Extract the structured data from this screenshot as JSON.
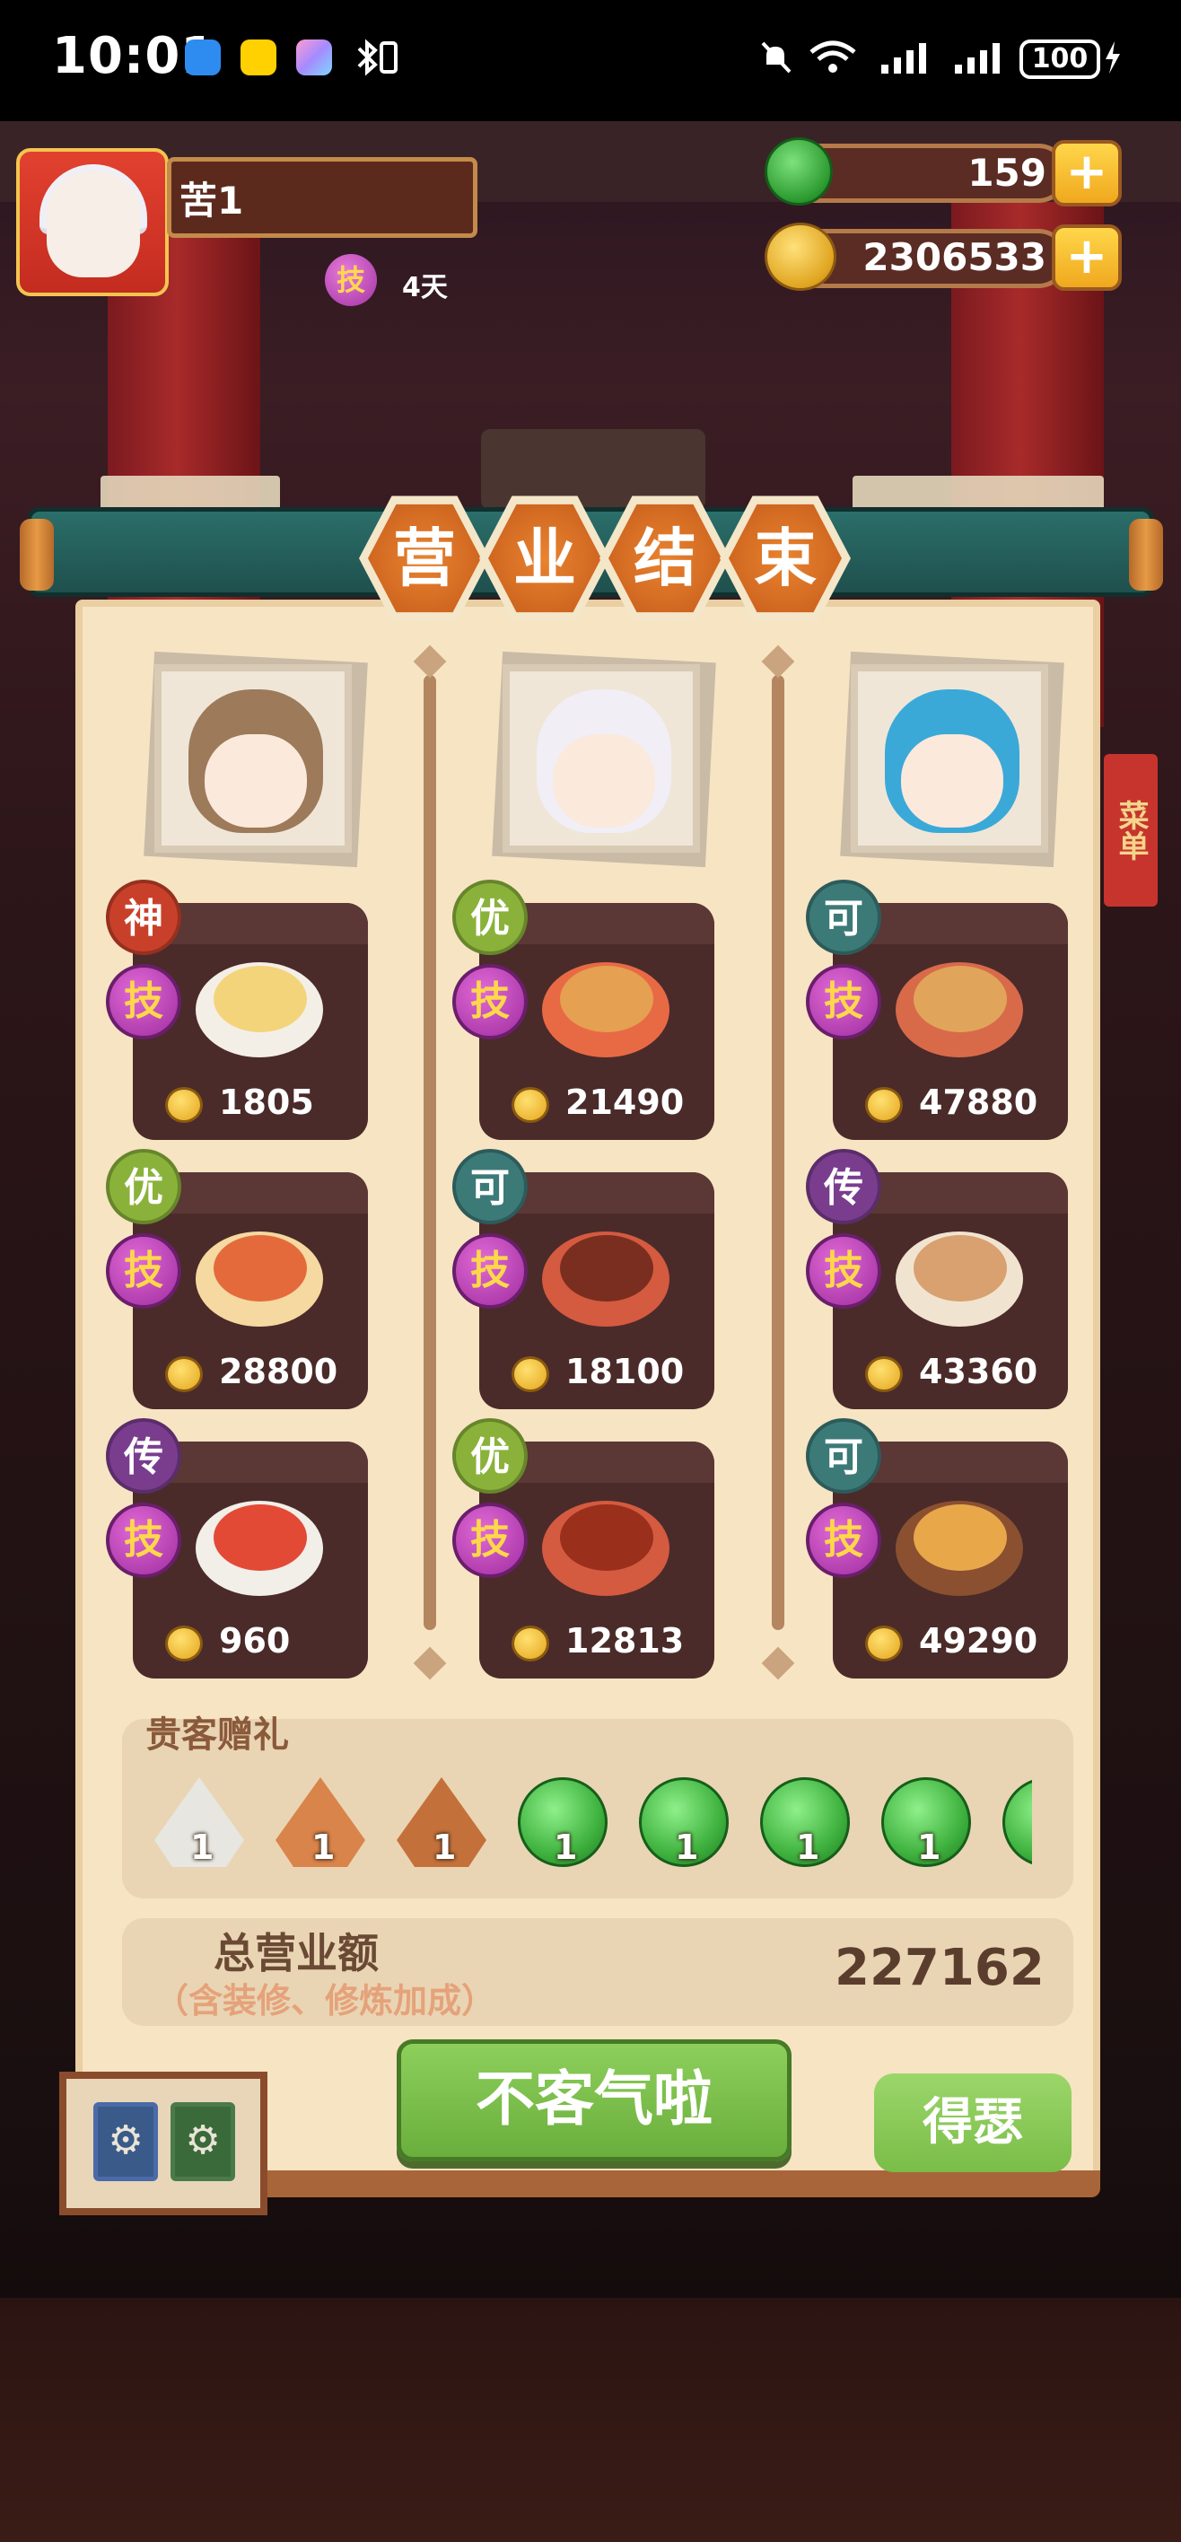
{
  "status_bar": {
    "time": "10:01",
    "app_icons": [
      "message-app-icon",
      "meituan-app-icon",
      "gallery-app-icon",
      "bluetooth-icon",
      "vibrate-icon"
    ],
    "right_icons": [
      "mute-icon",
      "wifi-icon",
      "signal-icon",
      "signal-icon-2"
    ],
    "battery": "100"
  },
  "header": {
    "player_name": "苦1",
    "skill_label": "技",
    "skill_days": "4天",
    "jade_value": "159",
    "coin_value": "2306533",
    "plus_label": "+"
  },
  "banner": {
    "chars": [
      "营",
      "业",
      "结",
      "束"
    ]
  },
  "background_side_label": "菜单",
  "chefs": [
    {
      "name": "chef-glasses",
      "hair": "#9c7a5a"
    },
    {
      "name": "chef-white-hair",
      "hair": "#f1eef6"
    },
    {
      "name": "chef-blue-hair",
      "hair": "#3aa9d8"
    }
  ],
  "dishes": [
    [
      {
        "rank": "神",
        "rank_color": "#c9402a",
        "skill": "技",
        "price": "1805",
        "food": "#f4d47a",
        "plate": "#f4efe6"
      },
      {
        "rank": "优",
        "rank_color": "#8ab23a",
        "skill": "技",
        "price": "28800",
        "food": "#e46a3c",
        "plate": "#f5d9a0"
      },
      {
        "rank": "传",
        "rank_color": "#7a3d8e",
        "skill": "技",
        "price": "960",
        "food": "#e34a36",
        "plate": "#f2eee8"
      }
    ],
    [
      {
        "rank": "优",
        "rank_color": "#8ab23a",
        "skill": "技",
        "price": "21490",
        "food": "#e5a052",
        "plate": "#e86a45"
      },
      {
        "rank": "可",
        "rank_color": "#3c7a78",
        "skill": "技",
        "price": "18100",
        "food": "#7a2e1f",
        "plate": "#d45a40"
      },
      {
        "rank": "优",
        "rank_color": "#8ab23a",
        "skill": "技",
        "price": "12813",
        "food": "#9a2f1c",
        "plate": "#d45a40"
      }
    ],
    [
      {
        "rank": "可",
        "rank_color": "#3c7a78",
        "skill": "技",
        "price": "47880",
        "food": "#e0a55a",
        "plate": "#d86a4a"
      },
      {
        "rank": "传",
        "rank_color": "#7a3d8e",
        "skill": "技",
        "price": "43360",
        "food": "#d9a070",
        "plate": "#f0e4d0"
      },
      {
        "rank": "可",
        "rank_color": "#3c7a78",
        "skill": "技",
        "price": "49290",
        "food": "#e8a84a",
        "plate": "#8a5030"
      }
    ]
  ],
  "gifts": {
    "title": "贵客赠礼",
    "items": [
      {
        "type": "silver-seed",
        "count": "1",
        "color": "#e8e6e0"
      },
      {
        "type": "sun-seed",
        "count": "1",
        "color": "#d9844a"
      },
      {
        "type": "rune-seed",
        "count": "1",
        "color": "#c4703a"
      },
      {
        "type": "jade",
        "count": "1",
        "color": "#3fb23f"
      },
      {
        "type": "jade",
        "count": "1",
        "color": "#3fb23f"
      },
      {
        "type": "jade",
        "count": "1",
        "color": "#3fb23f"
      },
      {
        "type": "jade",
        "count": "1",
        "color": "#3fb23f"
      },
      {
        "type": "jade",
        "count": "",
        "color": "#3fb23f"
      }
    ]
  },
  "total": {
    "label": "总营业额",
    "sublabel": "（含装修、修炼加成）",
    "value": "227162"
  },
  "buttons": {
    "main": "不客气啦",
    "side": "得瑟"
  }
}
